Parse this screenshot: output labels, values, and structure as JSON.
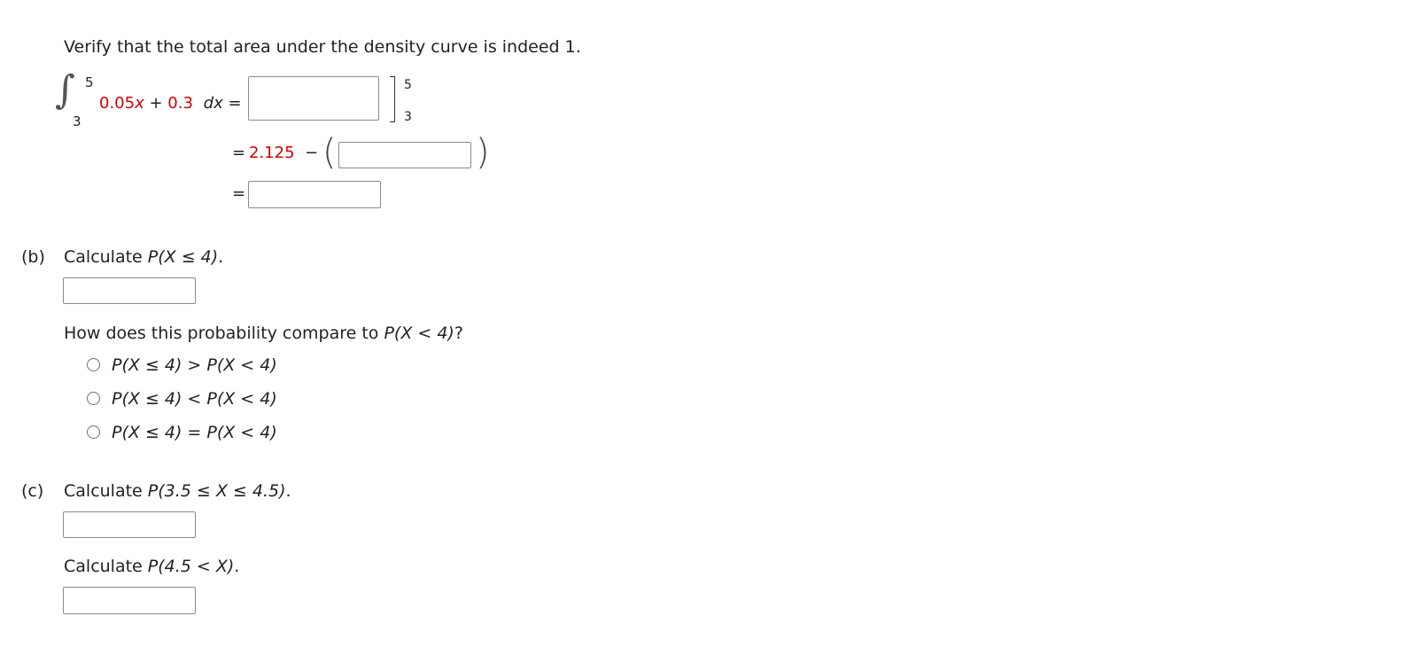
{
  "part_a": {
    "intro": "Verify that the total area under the density curve is indeed 1.",
    "integral": {
      "upper_limit": "5",
      "lower_limit": "3",
      "integrand_part1": "0.05",
      "variable": "x",
      "plus": " + ",
      "integrand_part2": "0.3",
      "differential": "dx",
      "equals": "="
    },
    "evaluation": {
      "upper": "5",
      "lower": "3"
    },
    "step2": {
      "equals": "=",
      "value": "2.125",
      "minus": "−"
    },
    "step3": {
      "equals": "="
    }
  },
  "part_b": {
    "label": "(b)",
    "prompt_prefix": "Calculate ",
    "prompt_math": "P(X ≤ 4)",
    "prompt_suffix": ".",
    "question_prefix": "How does this probability compare to ",
    "question_math": "P(X < 4)",
    "question_suffix": "?",
    "options": [
      {
        "math": "P(X ≤ 4) > P(X < 4)"
      },
      {
        "math": "P(X ≤ 4) < P(X < 4)"
      },
      {
        "math": "P(X ≤ 4) = P(X < 4)"
      }
    ]
  },
  "part_c": {
    "label": "(c)",
    "prompt_prefix": "Calculate ",
    "prompt_math": "P(3.5 ≤ X ≤ 4.5)",
    "prompt_suffix": ".",
    "prompt2_prefix": "Calculate ",
    "prompt2_math": "P(4.5 < X)",
    "prompt2_suffix": "."
  }
}
